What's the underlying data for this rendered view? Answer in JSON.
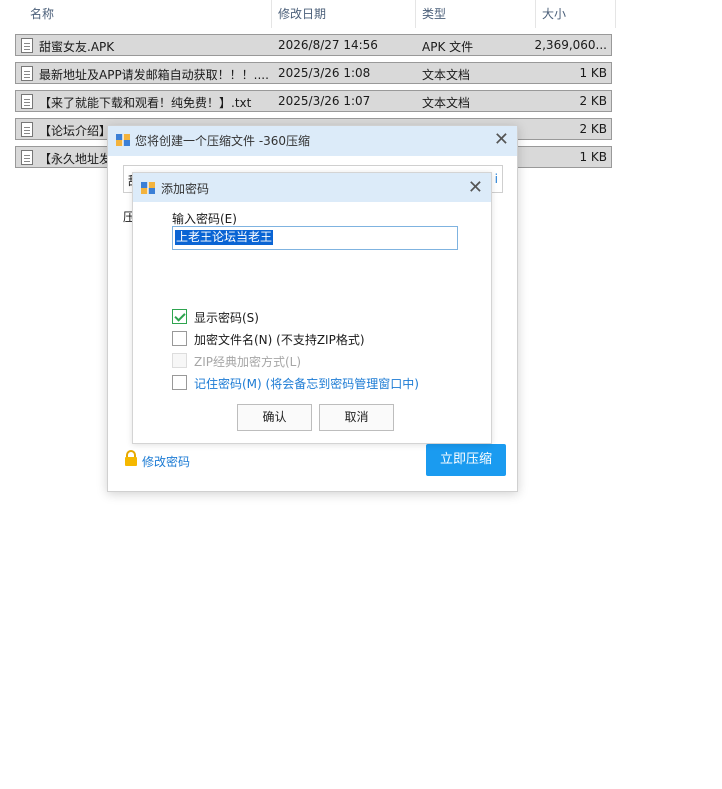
{
  "columns": {
    "name": "名称",
    "date": "修改日期",
    "type": "类型",
    "size": "大小"
  },
  "files": [
    {
      "name": "甜蜜女友.APK",
      "date": "2026/8/27 14:56",
      "type": "APK 文件",
      "size": "2,369,060..."
    },
    {
      "name": "最新地址及APP请发邮箱自动获取！！！....",
      "date": "2025/3/26 1:08",
      "type": "文本文档",
      "size": "1 KB"
    },
    {
      "name": "【来了就能下载和观看！纯免费！】.txt",
      "date": "2025/3/26 1:07",
      "type": "文本文档",
      "size": "2 KB"
    },
    {
      "name": "【论坛介绍】",
      "date": "",
      "type": "",
      "size": "2 KB"
    },
    {
      "name": "【永久地址发",
      "date": "",
      "type": "",
      "size": "1 KB"
    }
  ],
  "main_dialog": {
    "title": "您将创建一个压缩文件 -360压缩",
    "path_text": "甜",
    "path_suffix": "i",
    "label_ya": "压",
    "change_password": "修改密码",
    "compress_button": "立即压缩"
  },
  "password_dialog": {
    "title": "添加密码",
    "input_label": "输入密码(E)",
    "password_value": "上老王论坛当老王",
    "options": [
      {
        "label": "显示密码(S)",
        "checked": true,
        "disabled": false,
        "link": false
      },
      {
        "label": "加密文件名(N) (不支持ZIP格式)",
        "checked": false,
        "disabled": false,
        "link": false
      },
      {
        "label": "ZIP经典加密方式(L)",
        "checked": false,
        "disabled": true,
        "link": false
      },
      {
        "label": "记住密码(M) (将会备忘到密码管理窗口中)",
        "checked": false,
        "disabled": false,
        "link": true
      }
    ],
    "ok_button": "确认",
    "cancel_button": "取消"
  },
  "icons": {
    "file": "text-file-icon",
    "archive": "360-archive-icon",
    "lock": "lock-icon",
    "close": "close-icon"
  }
}
